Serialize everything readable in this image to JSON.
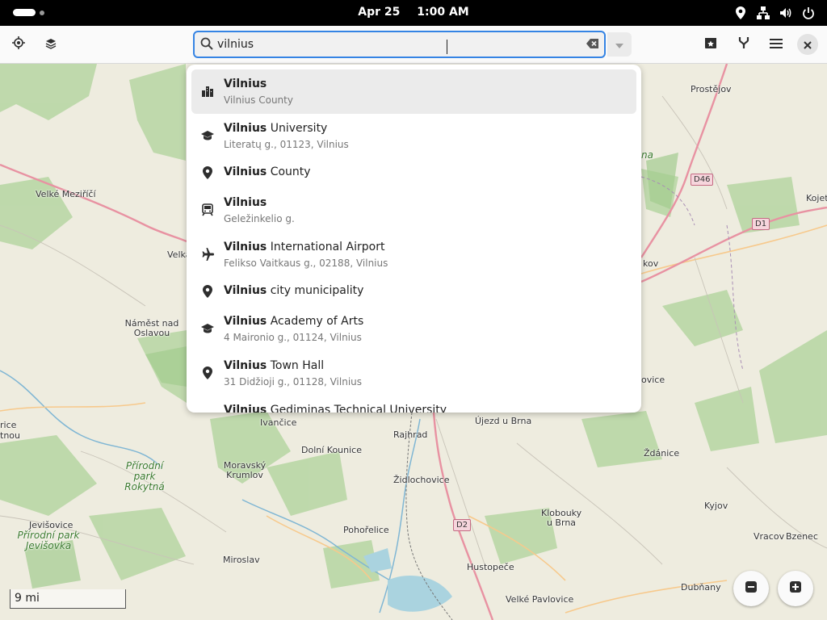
{
  "topbar": {
    "date": "Apr 25",
    "time": "1:00 AM"
  },
  "header": {
    "search_value": "vilnius",
    "icons": [
      "locate-icon",
      "layers-icon",
      "search-icon",
      "clear-icon",
      "chevron-down-icon",
      "favorites-icon",
      "route-icon",
      "menu-icon",
      "close-icon"
    ]
  },
  "results": [
    {
      "bold": "Vilnius",
      "rest": "",
      "sub": "Vilnius County",
      "icon": "city-icon"
    },
    {
      "bold": "Vilnius",
      "rest": " University",
      "sub": "Literatų g., 01123, Vilnius",
      "icon": "education-icon"
    },
    {
      "bold": "Vilnius",
      "rest": " County",
      "sub": "",
      "icon": "pin-icon"
    },
    {
      "bold": "Vilnius",
      "rest": "",
      "sub": "Geležinkelio g.",
      "icon": "train-icon"
    },
    {
      "bold": "Vilnius",
      "rest": " International Airport",
      "sub": "Felikso Vaitkaus g., 02188, Vilnius",
      "icon": "airplane-icon"
    },
    {
      "bold": "Vilnius",
      "rest": " city municipality",
      "sub": "",
      "icon": "pin-icon"
    },
    {
      "bold": "Vilnius",
      "rest": " Academy of Arts",
      "sub": "4 Maironio g., 01124, Vilnius",
      "icon": "education-icon"
    },
    {
      "bold": "Vilnius",
      "rest": " Town Hall",
      "sub": "31 Didžioji g., 01128, Vilnius",
      "icon": "pin-icon"
    },
    {
      "bold": "Vilnius",
      "rest": " Gediminas Technical University",
      "sub": "",
      "icon": "education-icon"
    }
  ],
  "map": {
    "places": [
      "Prostějov",
      "Velké Meziříčí",
      "Velka",
      "Kojet",
      "kov",
      "Náměst nad Oslavou",
      "ovice",
      "rice",
      "tnou",
      "Ivančice",
      "Rajhrad",
      "Újezd u Brna",
      "Ždánice",
      "Dolní Kounice",
      "Moravský Krumlov",
      "Židlochovice",
      "Jevišovice",
      "Pohořelice",
      "Klobouky u Brna",
      "Kyjov",
      "Vracov",
      "Bzenec",
      "Miroslav",
      "Hustopeče",
      "Velké Pavlovice",
      "Dubňany"
    ],
    "parks": [
      "Přírodní park Rokytná",
      "Přírodní park Jevišovka",
      "na"
    ],
    "shields": [
      "D46",
      "D1",
      "D2"
    ],
    "scale_text": "9 mi"
  },
  "colors": {
    "accent": "#3584e4",
    "land": "#f2efe9",
    "forest": "#add19e",
    "motorway": "#e892a2",
    "water": "#aad3df"
  }
}
